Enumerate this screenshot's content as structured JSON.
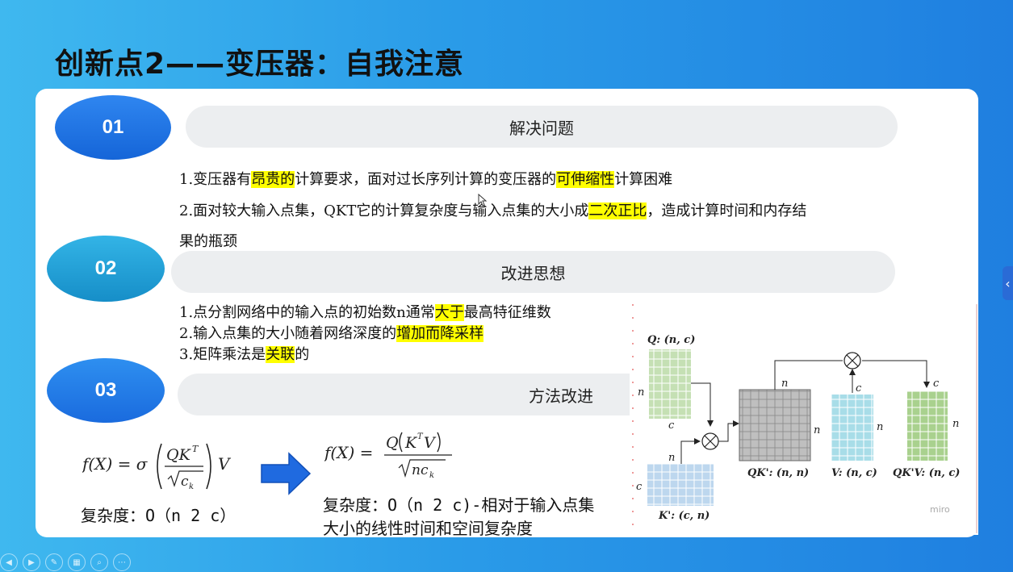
{
  "title": "创新点2——变压器：自我注意",
  "sections": [
    {
      "num": "01",
      "heading": "解决问题"
    },
    {
      "num": "02",
      "heading": "改进思想"
    },
    {
      "num": "03",
      "heading": "方法改进"
    }
  ],
  "problems": {
    "l1_a": "1.变压器有",
    "l1_hl1": "昂贵的",
    "l1_b": "计算要求，面对过长序列计算的变压器的",
    "l1_hl2": "可伸缩性",
    "l1_c": "计算困难",
    "l2_a": "2.面对较大输入点集，QKT它的计算复杂度与输入点集的大小成",
    "l2_hl": "二次正比",
    "l2_b": "，造成计算时间和内存结",
    "l3": "果的瓶颈"
  },
  "ideas": {
    "i1_a": "1.点分割网络中的输入点的初始数n通常",
    "i1_hl": "大于",
    "i1_b": "最高特征维数",
    "i2_a": "2.输入点集的大小随着网络深度的",
    "i2_hl": "增加而降采样",
    "i3_a": "3.矩阵乘法是",
    "i3_hl": "关联",
    "i3_b": "的"
  },
  "method": {
    "complexity_left": "复杂度：O（n 2 c）",
    "complexity_right_1": "复杂度：O（n 2 c)-相对于输入点集",
    "complexity_right_2": "大小的线性时间和空间复杂度"
  },
  "diagram": {
    "q_label": "Q: (n, c)",
    "k_label": "K': (c, n)",
    "qk_label": "QK': (n, n)",
    "v_label": "V: (n, c)",
    "qkv_label": "QK'V: (n, c)",
    "n": "n",
    "c": "c",
    "watermark": "miro"
  },
  "colors": {
    "highlight": "#ffff00",
    "accent": "#1565d8"
  }
}
